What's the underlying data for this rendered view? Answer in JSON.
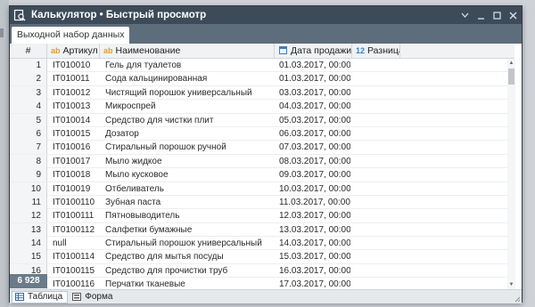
{
  "window": {
    "title": "Калькулятор • Быстрый просмотр"
  },
  "tabs": [
    "Выходной набор данных"
  ],
  "table": {
    "columns": {
      "num": "#",
      "article": "Артикул",
      "name": "Наименование",
      "date": "Дата продажи",
      "diff": "Разница"
    },
    "type_icons": {
      "text": "ab",
      "number": "12"
    },
    "rows": [
      {
        "n": "1",
        "article": "IT010010",
        "name": "Гель для туалетов",
        "date": "01.03.2017, 00:00"
      },
      {
        "n": "2",
        "article": "IT010011",
        "name": "Сода кальцинированная",
        "date": "01.03.2017, 00:00"
      },
      {
        "n": "3",
        "article": "IT010012",
        "name": "Чистящий порошок универсальный",
        "date": "03.03.2017, 00:00"
      },
      {
        "n": "4",
        "article": "IT010013",
        "name": "Микроспрей",
        "date": "04.03.2017, 00:00"
      },
      {
        "n": "5",
        "article": "IT010014",
        "name": "Средство для чистки плит",
        "date": "05.03.2017, 00:00"
      },
      {
        "n": "6",
        "article": "IT010015",
        "name": "Дозатор",
        "date": "06.03.2017, 00:00"
      },
      {
        "n": "7",
        "article": "IT010016",
        "name": "Стиральный порошок ручной",
        "date": "07.03.2017, 00:00"
      },
      {
        "n": "8",
        "article": "IT010017",
        "name": "Мыло жидкое",
        "date": "08.03.2017, 00:00"
      },
      {
        "n": "9",
        "article": "IT010018",
        "name": "Мыло кусковое",
        "date": "09.03.2017, 00:00"
      },
      {
        "n": "10",
        "article": "IT010019",
        "name": "Отбеливатель",
        "date": "10.03.2017, 00:00"
      },
      {
        "n": "11",
        "article": "IT0100110",
        "name": "Зубная паста",
        "date": "11.03.2017, 00:00"
      },
      {
        "n": "12",
        "article": "IT0100111",
        "name": "Пятновыводитель",
        "date": "12.03.2017, 00:00"
      },
      {
        "n": "13",
        "article": "IT0100112",
        "name": "Салфетки бумажные",
        "date": "13.03.2017, 00:00"
      },
      {
        "n": "14",
        "article": "null",
        "name": "Стиральный порошок универсальный",
        "date": "14.03.2017, 00:00"
      },
      {
        "n": "15",
        "article": "IT0100114",
        "name": "Средство для мытья посуды",
        "date": "15.03.2017, 00:00"
      },
      {
        "n": "16",
        "article": "IT0100115",
        "name": "Средство для прочистки труб",
        "date": "16.03.2017, 00:00"
      },
      {
        "n": "17",
        "article": "IT0100116",
        "name": "Перчатки тканевые",
        "date": "17.03.2017, 00:00"
      }
    ],
    "row_count": "6 928"
  },
  "bottom_tabs": [
    {
      "label": "Таблица",
      "icon": "table-icon",
      "active": true
    },
    {
      "label": "Форма",
      "icon": "form-icon",
      "active": false
    }
  ],
  "colors": {
    "titlebar": "#3d4a57",
    "tabbar": "#5d6d7c",
    "text_type": "#e59a2b",
    "number_type": "#3b7fc4"
  }
}
